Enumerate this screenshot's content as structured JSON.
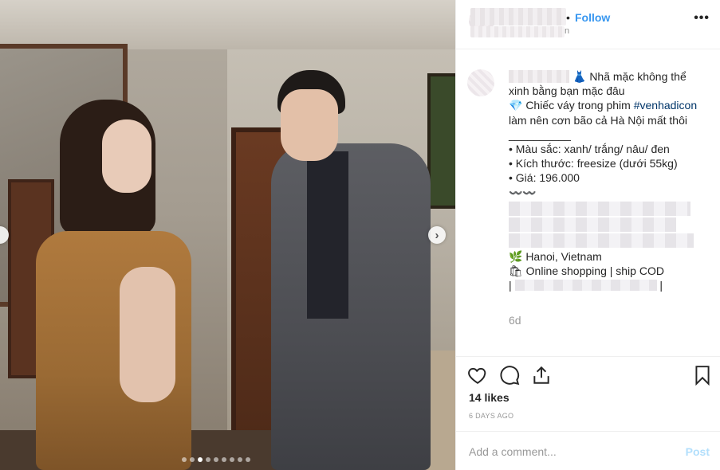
{
  "header": {
    "follow_label": "Follow",
    "separator": "•",
    "location_tail": "n",
    "more_icon": "more-horizontal-icon",
    "more_glyph": "•••"
  },
  "caption": {
    "line1": "👗 Nhã mặc không thể",
    "line2": "xinh bằng bạn mặc đâu",
    "line3_prefix": "💎 Chiếc váy trong phim ",
    "hashtag": "#venhadicon",
    "line4": "làm nên cơn bão cả Hà Nội mất thôi",
    "divider": "__________",
    "bullet_color": "• Màu sắc: xanh/ trắng/ nâu/ đen",
    "bullet_size": "• Kích thước: freesize (dưới 55kg)",
    "bullet_price": "• Giá: 196.000",
    "squiggle": "〰️〰️",
    "location_line": "🌿 Hanoi, Vietnam",
    "shop_line": "🛍 Online shopping | ship COD",
    "pipe_left": "|",
    "pipe_right": "|"
  },
  "time_ago": "6d",
  "likes": "14 likes",
  "posted": "6 DAYS AGO",
  "comment_input": {
    "placeholder": "Add a comment..."
  },
  "post_label": "Post",
  "carousel": {
    "count": 9,
    "active_index": 2,
    "next_glyph": "›"
  },
  "colors": {
    "follow": "#3897f0",
    "hashtag": "#003569",
    "muted": "#999999",
    "post_disabled": "#b2dffc"
  },
  "icons": [
    "heart-icon",
    "comment-icon",
    "share-icon",
    "bookmark-icon",
    "chevron-right-icon"
  ]
}
